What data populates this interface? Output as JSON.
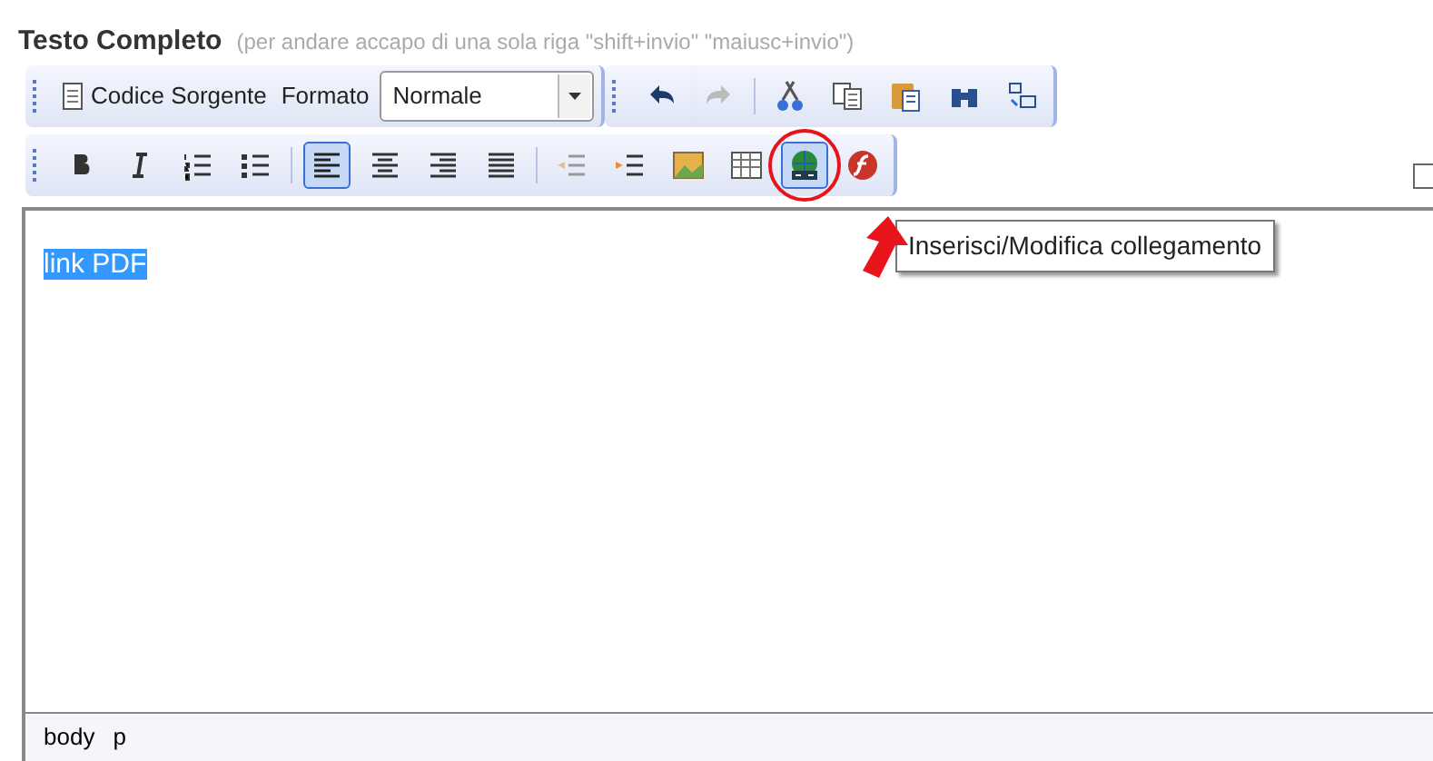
{
  "field": {
    "label": "Testo Completo",
    "hint": "(per andare accapo di una sola riga \"shift+invio\" \"maiusc+invio\")"
  },
  "toolbar_rows": [
    {
      "groups": [
        [
          {
            "kind": "text_button",
            "label": "Codice Sorgente",
            "selected": false
          },
          {
            "kind": "label",
            "label": "Formato"
          },
          {
            "kind": "select",
            "value": "Normale"
          }
        ],
        [
          {
            "kind": "button",
            "selected": false
          },
          {
            "kind": "button",
            "selected": false
          },
          {
            "kind": "separator"
          },
          {
            "kind": "button",
            "selected": false
          },
          {
            "kind": "button",
            "selected": false
          },
          {
            "kind": "button",
            "selected": false
          },
          {
            "kind": "button",
            "selected": false
          },
          {
            "kind": "button",
            "selected": false
          }
        ]
      ]
    },
    {
      "groups": [
        [
          {
            "kind": "button",
            "selected": false
          },
          {
            "kind": "button",
            "selected": false
          },
          {
            "kind": "button",
            "selected": false
          },
          {
            "kind": "button",
            "selected": false
          },
          {
            "kind": "separator"
          },
          {
            "kind": "button",
            "selected": true
          },
          {
            "kind": "button",
            "selected": false
          },
          {
            "kind": "button",
            "selected": false
          },
          {
            "kind": "button",
            "selected": false
          },
          {
            "kind": "separator"
          },
          {
            "kind": "button",
            "selected": false
          },
          {
            "kind": "button",
            "selected": false
          },
          {
            "kind": "button",
            "selected": false
          },
          {
            "kind": "button",
            "selected": false
          },
          {
            "kind": "button",
            "selected": true,
            "circled": true
          },
          {
            "kind": "button",
            "selected": false
          }
        ]
      ]
    }
  ],
  "editor": {
    "text": "link PDF",
    "text_selected": true
  },
  "tooltip": "Inserisci/Modifica collegamento",
  "status_bar": [
    "body",
    "p"
  ]
}
